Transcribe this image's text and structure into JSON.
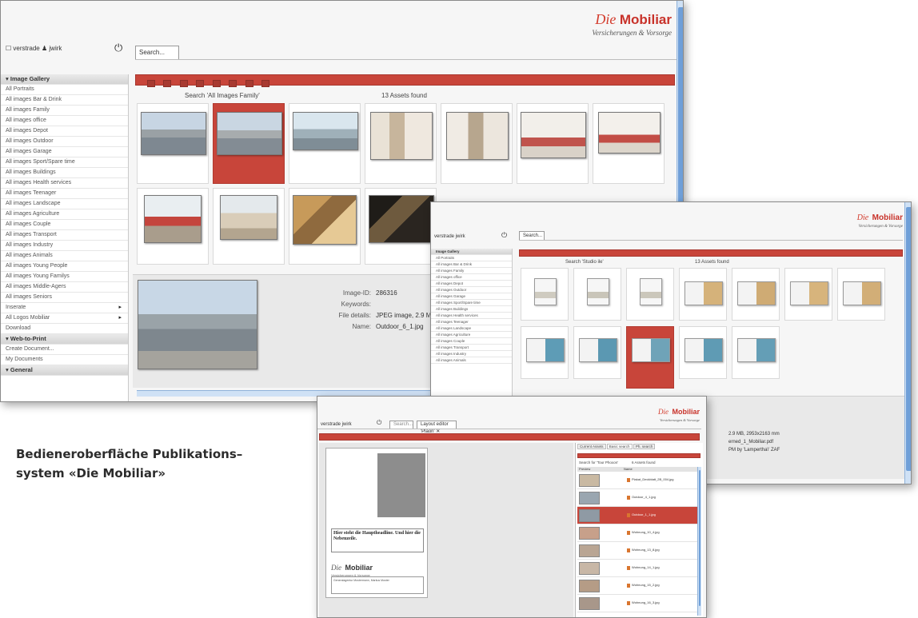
{
  "caption": {
    "line1": "Bedieneroberfläche Publikations–",
    "line2": "system «Die Mobiliar»"
  },
  "brand": {
    "die": "Die",
    "name": "Mobiliar",
    "tagline": "Versicherungen & Vorsorge"
  },
  "colors": {
    "accent": "#c8453a",
    "scroll": "#6f9fd8",
    "panel": "#e9e9e9"
  },
  "screen1": {
    "user": {
      "icon": "checkbox-icon",
      "name": "verstrade",
      "person_icon": "user-icon",
      "login": "jwirk"
    },
    "power_icon": "power-icon",
    "search_tab": "Search...",
    "search_label": "Search 'All Images Family'",
    "assets_found": "13 Assets found",
    "sidebar": {
      "gallery_header": "Image Gallery",
      "items": [
        "All Portraits",
        "All images Bar & Drink",
        "All images Family",
        "All images office",
        "All images Depot",
        "All images Outdoor",
        "All images Garage",
        "All images Sport/Spare time",
        "All images Buildings",
        "All images Health services",
        "All images Teenager",
        "All images Landscape",
        "All images Agriculture",
        "All images Couple",
        "All images Transport",
        "All images Industry",
        "All images Animals",
        "All images Young People",
        "All images Young Familys",
        "All images Middle-Agers",
        "All images Seniors",
        "Inserate",
        "All Logos Mobiliar",
        "Download"
      ],
      "submenu_items": [
        "Inserate",
        "All Logos Mobiliar"
      ],
      "web_header": "Web-to-Print",
      "web_items": [
        "Create Document...",
        "My Documents"
      ],
      "general_header": "General"
    },
    "detail": {
      "id_label": "Image-ID:",
      "id_value": "286316",
      "kw_label": "Keywords:",
      "kw_value": "",
      "fd_label": "File details:",
      "fd_value": "JPEG image, 2.9 MB, 284",
      "name_label": "Name:",
      "name_value": "Outdoor_6_1.jpg"
    }
  },
  "screen2": {
    "user": "verstrade  jwirk",
    "search_tab": "Search...",
    "search_label": "Search 'Studio ile'",
    "assets_found": "13 Assets found",
    "sidebar": [
      "Image Gallery",
      "All Portraits",
      "All images Bar & Drink",
      "All images Family",
      "All images office",
      "All images Depot",
      "All images Outdoor",
      "All images Garage",
      "All images Sport/Spare time",
      "All images Buildings",
      "All images Health services",
      "All images Teenager",
      "All images Landscape",
      "All images Agriculture",
      "All images Couple",
      "All images Transport",
      "All images Industry",
      "All images Animals"
    ],
    "detail": {
      "line1": "2.9 MB, 2953x2163 mm",
      "line2": "erned_1_Mobiliar.pdf",
      "line3": "PM by 'Lampertha\\' ZAF"
    }
  },
  "screen3": {
    "user": "verstrade  jwirk",
    "tabs": [
      "Search...",
      "Layout editor 'Plaon' ✕"
    ],
    "panel_tabs": [
      "Current Assets",
      "Basic search",
      "Ph. search"
    ],
    "search_label": "Search for 'Tour Phoxon'",
    "assets_found": "6 Assets found",
    "col_preview": "Preview",
    "col_name": "Name",
    "files": [
      "Plakat_Deckblatt_2B_004.jpg",
      "Outdoor_4_1.jpg",
      "Outdoor_1_1.jpg",
      "Wohnung_10_4.jpg",
      "Wohnung_13_8.jpg",
      "Wohnung_14_1.jpg",
      "Wohnung_15_2.jpg",
      "Wohnung_16_3.jpg"
    ],
    "doc": {
      "headline": "Hier steht die Hauptheadline. Und hier die Nebenzeile.",
      "logo_die": "Die",
      "logo_name": "Mobiliar",
      "tagline": "Versicherungen & Vorsorge",
      "box_text": "Generalagentur Mustermann, Markus Muster"
    }
  }
}
